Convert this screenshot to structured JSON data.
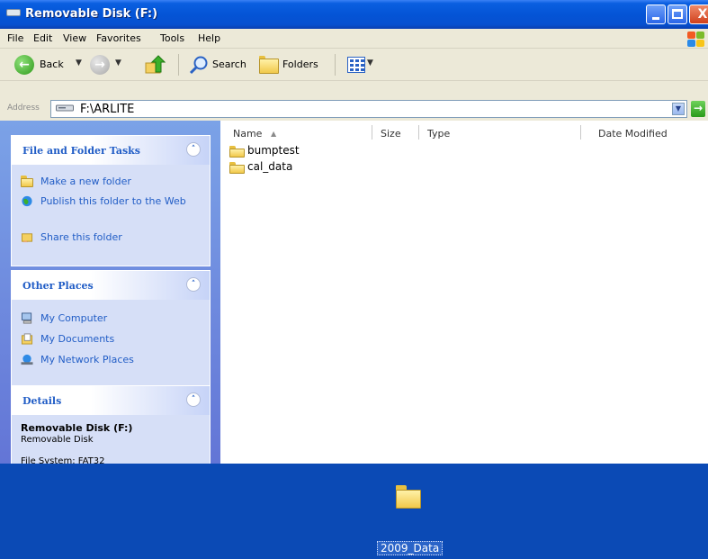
{
  "window": {
    "title": "Removable Disk (F:)",
    "close_glyph": "X"
  },
  "menu": [
    "File",
    "Edit",
    "View",
    "Favorites",
    "Tools",
    "Help"
  ],
  "toolbar": {
    "back_label": "Back",
    "search_label": "Search",
    "folders_label": "Folders"
  },
  "address": {
    "label": "Address",
    "value": "F:\\ARLITE",
    "go_label": "Go"
  },
  "panels": {
    "tasks": {
      "title": "File and Folder Tasks",
      "items": [
        {
          "label": "Make a new folder",
          "icon": "new-folder-icon"
        },
        {
          "label": "Publish this folder to the Web",
          "icon": "publish-web-icon"
        },
        {
          "label": "Share this folder",
          "icon": "share-folder-icon"
        }
      ]
    },
    "places": {
      "title": "Other Places",
      "items": [
        {
          "label": "My Computer",
          "icon": "my-computer-icon"
        },
        {
          "label": "My Documents",
          "icon": "my-documents-icon"
        },
        {
          "label": "My Network Places",
          "icon": "network-places-icon"
        }
      ]
    },
    "details": {
      "title": "Details",
      "name": "Removable Disk (F:)",
      "type": "Removable Disk",
      "filesystem": "File System: FAT32"
    }
  },
  "filelist": {
    "columns": {
      "name": "Name",
      "size": "Size",
      "type": "Type",
      "date": "Date Modified"
    },
    "rows": [
      {
        "name": "bumptest"
      },
      {
        "name": "cal_data"
      }
    ]
  },
  "desktop": {
    "icon_label": "2009_Data"
  },
  "colors": {
    "titlebar": "#0454d6",
    "taskpane": "#7ba2e7",
    "panel_title": "#215dc6",
    "desktop": "#0b4ab5"
  }
}
